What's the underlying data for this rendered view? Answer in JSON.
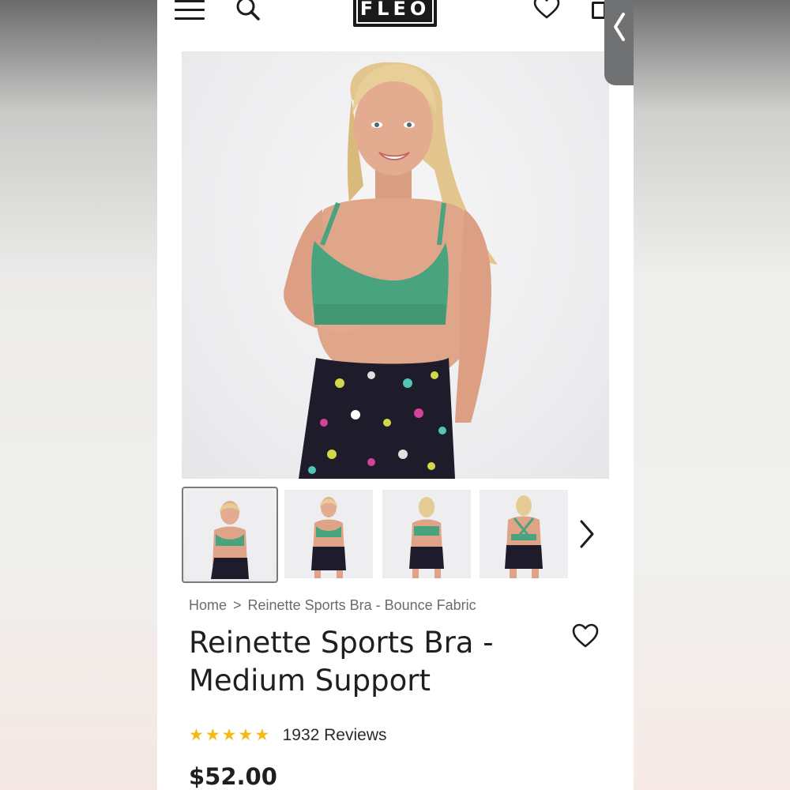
{
  "header": {
    "logo_text": "FLEO",
    "menu_icon": "hamburger-menu-icon",
    "search_icon": "search-icon",
    "wishlist_icon": "heart-outline-icon",
    "cart_icon": "shopping-bag-icon"
  },
  "side_tab": {
    "icon": "chevron-left-icon"
  },
  "gallery": {
    "thumbnails": [
      {
        "view": "front, hand at band",
        "selected": true
      },
      {
        "view": "front",
        "selected": false
      },
      {
        "view": "back",
        "selected": false
      },
      {
        "view": "back close",
        "selected": false
      }
    ],
    "next_icon": "chevron-right-icon"
  },
  "breadcrumb": {
    "home": "Home",
    "separator": ">",
    "current": "Reinette Sports Bra - Bounce Fabric"
  },
  "product": {
    "title_line1": "Reinette Sports Bra -",
    "title_line2": "Medium Support",
    "rating_stars": 5,
    "reviews": "1932 Reviews",
    "price": "$52.00"
  },
  "colors": {
    "bra_green": "#4aa37f",
    "star_gold": "#f3b916",
    "text_dark": "#1f1f1f",
    "breadcrumb_gray": "#6b6b6b"
  }
}
